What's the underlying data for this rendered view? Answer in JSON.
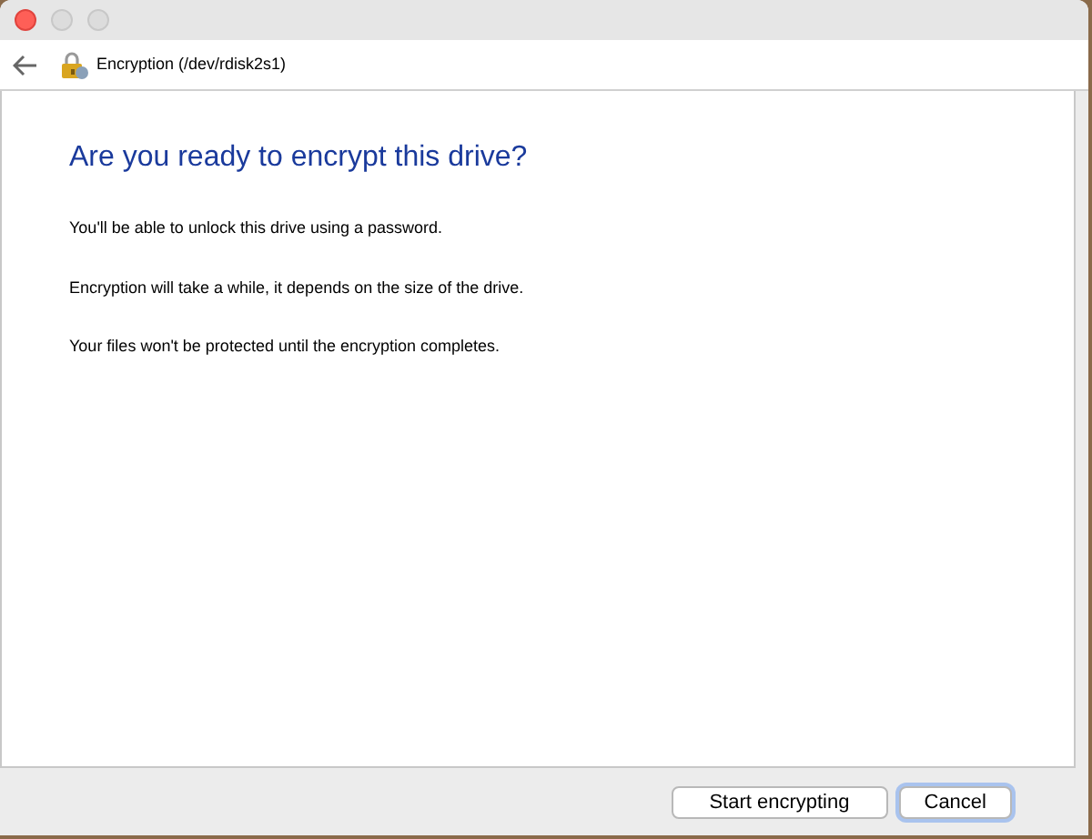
{
  "header": {
    "title": "Encryption (/dev/rdisk2s1)"
  },
  "heading": "Are you ready to encrypt this drive?",
  "paragraphs": [
    "You'll be able to unlock this drive using a password.",
    "Encryption will take a while, it depends on the size of the drive.",
    "Your files won't be protected until the encryption completes."
  ],
  "buttons": [
    {
      "label": "Start encrypting",
      "default": false
    },
    {
      "label": "Cancel",
      "default": true
    }
  ]
}
